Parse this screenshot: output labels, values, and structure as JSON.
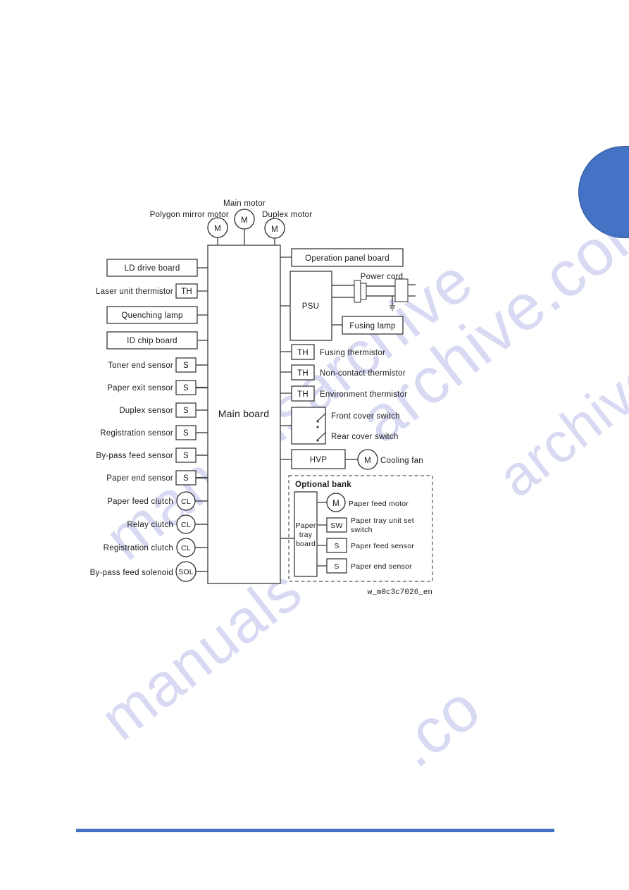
{
  "page": {
    "figure_caption": "w_m0c3c7026_en",
    "accent_color": "#4472c4",
    "watermark_text": [
      "manualsarchive",
      "archive.com",
      "manuals",
      ".co",
      "archive"
    ]
  },
  "diagram": {
    "title_block": "Main board",
    "motors": [
      {
        "label": "Polygon mirror motor",
        "symbol": "M"
      },
      {
        "label": "Main motor",
        "symbol": "M"
      },
      {
        "label": "Duplex motor",
        "symbol": "M"
      }
    ],
    "left_items": [
      {
        "label": "LD drive board",
        "style": "wide-box",
        "symbol": ""
      },
      {
        "label": "Laser unit thermistor",
        "style": "symbol-box",
        "symbol": "TH"
      },
      {
        "label": "Quenching lamp",
        "style": "wide-box",
        "symbol": ""
      },
      {
        "label": "ID chip board",
        "style": "wide-box",
        "symbol": ""
      },
      {
        "label": "Toner end sensor",
        "style": "symbol-box",
        "symbol": "S"
      },
      {
        "label": "Paper exit sensor",
        "style": "symbol-box",
        "symbol": "S"
      },
      {
        "label": "Duplex sensor",
        "style": "symbol-box",
        "symbol": "S"
      },
      {
        "label": "Registration sensor",
        "style": "symbol-box",
        "symbol": "S"
      },
      {
        "label": "By-pass feed sensor",
        "style": "symbol-box",
        "symbol": "S"
      },
      {
        "label": "Paper end sensor",
        "style": "symbol-box",
        "symbol": "S"
      },
      {
        "label": "Paper feed clutch",
        "style": "symbol-circle",
        "symbol": "CL"
      },
      {
        "label": "Relay clutch",
        "style": "symbol-circle",
        "symbol": "CL"
      },
      {
        "label": "Registration clutch",
        "style": "symbol-circle",
        "symbol": "CL"
      },
      {
        "label": "By-pass feed solenoid",
        "style": "symbol-circle",
        "symbol": "SOL"
      }
    ],
    "right_items": {
      "operation_panel_board": "Operation panel board",
      "psu": "PSU",
      "power_cord": "Power cord",
      "fusing_lamp": "Fusing lamp",
      "thermistors": [
        {
          "symbol": "TH",
          "label": "Fusing thermistor"
        },
        {
          "symbol": "TH",
          "label": "Non-contact thermistor"
        },
        {
          "symbol": "TH",
          "label": "Environment thermistor"
        }
      ],
      "cover_switches": [
        "Front cover switch",
        "Rear cover switch"
      ],
      "hvp": "HVP",
      "cooling_fan": {
        "symbol": "M",
        "label": "Cooling fan"
      }
    },
    "optional_bank": {
      "title": "Optional bank",
      "board_label_lines": [
        "Paper",
        "tray",
        "board"
      ],
      "items": [
        {
          "symbol": "M",
          "shape": "circle",
          "label_lines": [
            "Paper feed motor"
          ]
        },
        {
          "symbol": "SW",
          "shape": "box",
          "label_lines": [
            "Paper tray unit set",
            "switch"
          ]
        },
        {
          "symbol": "S",
          "shape": "box",
          "label_lines": [
            "Paper feed sensor"
          ]
        },
        {
          "symbol": "S",
          "shape": "box",
          "label_lines": [
            "Paper end sensor"
          ]
        }
      ]
    }
  }
}
